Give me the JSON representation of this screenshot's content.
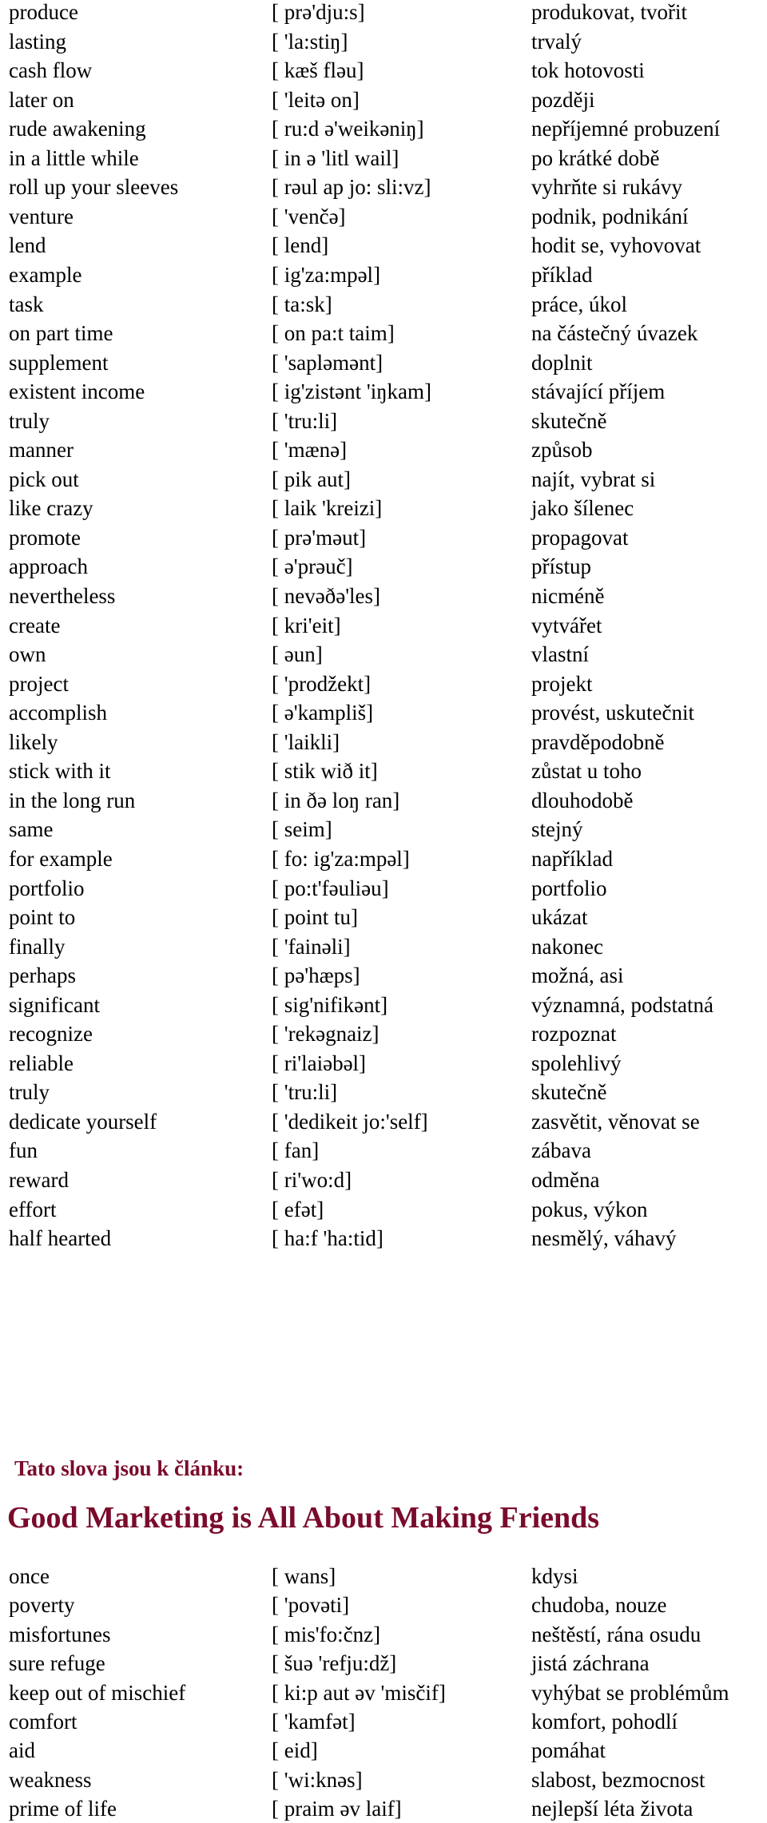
{
  "vocabulary_1": [
    [
      "produce",
      "[ prə'dju:s]",
      "produkovat, tvořit"
    ],
    [
      "lasting",
      "[ 'la:stiŋ]",
      "trvalý"
    ],
    [
      "cash flow",
      "[ kæš fləu]",
      "tok hotovosti"
    ],
    [
      "later on",
      "[ 'leitə on]",
      "později"
    ],
    [
      "rude awakening",
      "[ ru:d ə'weikəniŋ]",
      "nepříjemné probuzení"
    ],
    [
      "in a little while",
      "[ in ə 'litl wail]",
      "po krátké době"
    ],
    [
      "roll up your sleeves",
      "[ rəul ap jo: sli:vz]",
      "vyhrňte si rukávy"
    ],
    [
      "venture",
      "[ 'venčə]",
      "podnik, podnikání"
    ],
    [
      "lend",
      "[ lend]",
      "hodit se, vyhovovat"
    ],
    [
      "example",
      "[ ig'za:mpəl]",
      "příklad"
    ],
    [
      "task",
      "[ ta:sk]",
      "práce, úkol"
    ],
    [
      "on part time",
      "[ on pa:t taim]",
      "na částečný úvazek"
    ],
    [
      "supplement",
      "[ 'sapləmənt]",
      "doplnit"
    ],
    [
      "existent income",
      "[ ig'zistənt 'iŋkam]",
      "stávající příjem"
    ],
    [
      "truly",
      "[ 'tru:li]",
      "skutečně"
    ],
    [
      "manner",
      "[ 'mænə]",
      "způsob"
    ],
    [
      "pick out",
      "[ pik aut]",
      "najít, vybrat si"
    ],
    [
      "like crazy",
      "[ laik 'kreizi]",
      "jako šílenec"
    ],
    [
      "promote",
      "[ prə'məut]",
      "propagovat"
    ],
    [
      "approach",
      "[ ə'prəuč]",
      "přístup"
    ],
    [
      "nevertheless",
      "[ nevəðə'les]",
      "nicméně"
    ],
    [
      "create",
      "[ kri'eit]",
      "vytvářet"
    ],
    [
      "own",
      "[ əun]",
      "vlastní"
    ],
    [
      "project",
      "[ 'prodžekt]",
      "projekt"
    ],
    [
      "accomplish",
      "[ ə'kampliš]",
      "provést, uskutečnit"
    ],
    [
      "likely",
      "[ 'laikli]",
      "pravděpodobně"
    ],
    [
      "stick with it",
      "[ stik wið it]",
      "zůstat u toho"
    ],
    [
      "in the long run",
      "[ in ðə loŋ ran]",
      "dlouhodobě"
    ],
    [
      "same",
      "[ seim]",
      "stejný"
    ],
    [
      "for example",
      "[ fo: ig'za:mpəl]",
      "například"
    ],
    [
      "portfolio",
      "[ po:t'fəuliəu]",
      "portfolio"
    ],
    [
      "point to",
      "[ point tu]",
      "ukázat"
    ],
    [
      "finally",
      "[ 'fainəli]",
      "nakonec"
    ],
    [
      "perhaps",
      "[ pə'hæps]",
      "možná, asi"
    ],
    [
      "significant",
      "[ sig'nifikənt]",
      "významná, podstatná"
    ],
    [
      "recognize",
      "[ 'rekəgnaiz]",
      "rozpoznat"
    ],
    [
      "reliable",
      "[ ri'laiəbəl]",
      "spolehlivý"
    ],
    [
      "truly",
      "[ 'tru:li]",
      "skutečně"
    ],
    [
      "dedicate yourself",
      "[ 'dedikeit jo:'self]",
      "zasvětit, věnovat se"
    ],
    [
      "fun",
      "[ fan]",
      "zábava"
    ],
    [
      "reward",
      "[ ri'wo:d]",
      "odměna"
    ],
    [
      "effort",
      "[ efət]",
      "pokus, výkon"
    ],
    [
      "half hearted",
      "[ ha:f 'ha:tid]",
      "nesmělý, váhavý"
    ]
  ],
  "section_heading": "Tato slova jsou k článku:",
  "article_title": "Good Marketing is All About Making Friends",
  "accent_color": "#7a0b2b",
  "vocabulary_2": [
    [
      "once",
      "[ wans]",
      "kdysi"
    ],
    [
      "poverty",
      "[ 'povəti]",
      "chudoba, nouze"
    ],
    [
      "misfortunes",
      "[ mis'fo:čnz]",
      "neštěstí, rána osudu"
    ],
    [
      "sure refuge",
      "[ šuə 'refju:dž]",
      "jistá záchrana"
    ],
    [
      "keep out of mischief",
      "[ ki:p aut əv 'misčif]",
      "vyhýbat se problémům"
    ],
    [
      "comfort",
      "[ 'kamfət]",
      "komfort, pohodlí"
    ],
    [
      "aid",
      "[ eid]",
      "pomáhat"
    ],
    [
      "weakness",
      "[ 'wi:knəs]",
      "slabost, bezmocnost"
    ],
    [
      "prime of life",
      "[ praim əv laif]",
      "nejlepší léta života"
    ]
  ]
}
